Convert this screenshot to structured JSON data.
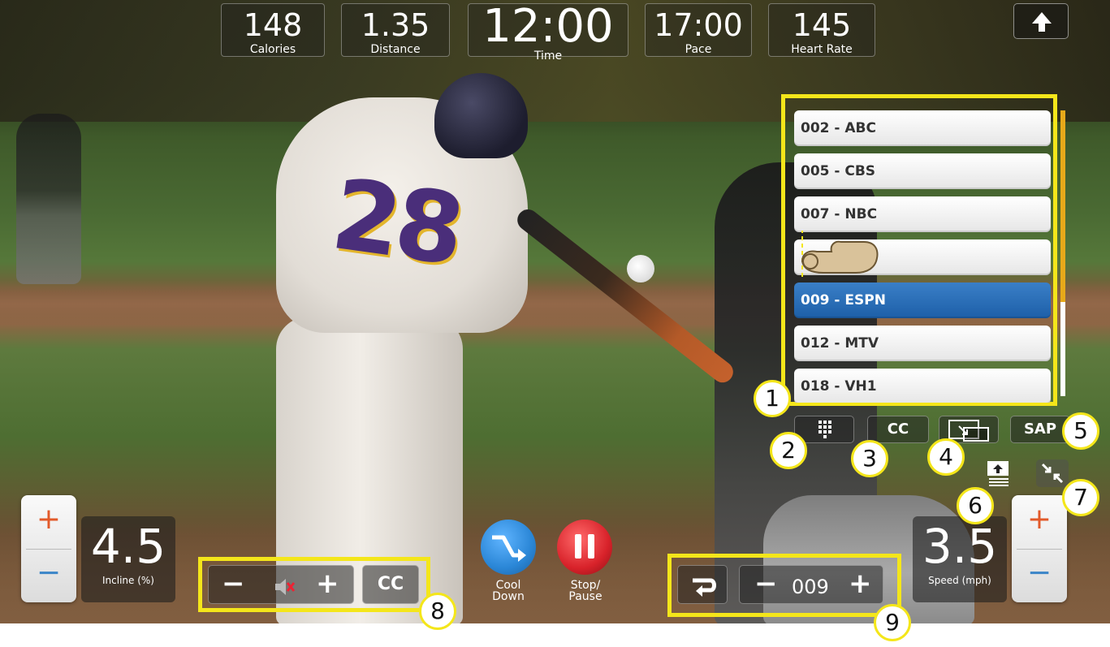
{
  "stats": [
    {
      "value": "148",
      "label": "Calories"
    },
    {
      "value": "1.35",
      "label": "Distance"
    },
    {
      "value": "12:00",
      "label": "Time"
    },
    {
      "value": "17:00",
      "label": "Pace"
    },
    {
      "value": "145",
      "label": "Heart Rate"
    }
  ],
  "channels": [
    {
      "label": "002 - ABC"
    },
    {
      "label": "005 - CBS"
    },
    {
      "label": "007 - NBC"
    },
    {
      "label": ""
    },
    {
      "label": "009 - ESPN",
      "selected": true
    },
    {
      "label": "012 - MTV"
    },
    {
      "label": "018 - VH1"
    }
  ],
  "tv_controls": {
    "cc": "CC",
    "sap": "SAP"
  },
  "callouts": [
    "1",
    "2",
    "3",
    "4",
    "5",
    "6",
    "7",
    "8",
    "9"
  ],
  "incline": {
    "value": "4.5",
    "label": "Incline (%)",
    "plus": "+",
    "minus": "−"
  },
  "speed": {
    "value": "3.5",
    "label": "Speed (mph)",
    "plus": "+",
    "minus": "−"
  },
  "volume": {
    "minus": "−",
    "plus": "+",
    "cc": "CC"
  },
  "cooldown": {
    "label_line1": "Cool",
    "label_line2": "Down"
  },
  "stop": {
    "label_line1": "Stop/",
    "label_line2": "Pause"
  },
  "channel_nav": {
    "minus": "−",
    "current": "009",
    "plus": "+"
  },
  "colors": {
    "highlight": "#f4e61a",
    "selected_channel": "#1d5fa8",
    "scroll_thumb": "#e7a91a",
    "cooldown": "#2a86d6",
    "stop": "#d8222a"
  }
}
